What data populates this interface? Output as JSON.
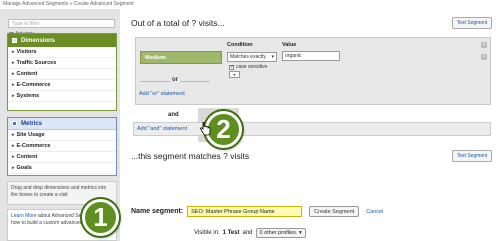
{
  "breadcrumb": "Manage Advanced Segments » Create Advanced Segment",
  "left_panel": {
    "filter_placeholder": "Type to filter",
    "list_view_label": "list view",
    "dimensions": {
      "title": "Dimensions",
      "items": [
        "Visitors",
        "Traffic Sources",
        "Content",
        "E-Commerce",
        "Systems"
      ]
    },
    "metrics": {
      "title": "Metrics",
      "items": [
        "Site Usage",
        "E-Commerce",
        "Content",
        "Goals"
      ]
    },
    "help_drag": "Drag and drop dimensions and metrics into the boxes to create a visit",
    "help_learn_link": "Learn More",
    "help_learn_text": "about Advanced Segments and how to build a custom advanced segment."
  },
  "main": {
    "total_title": "Out of a total of ? visits...",
    "test_segment_label": "Test Segment",
    "condition_header": "Condition",
    "value_header": "Value",
    "dimension_pill": "Medium",
    "condition_value": "Matches exactly",
    "value_text": "organic",
    "case_sensitive_label": "case sensitive",
    "or_label": "or",
    "add_or_label": "Add \"or\" statement",
    "and_label": "and",
    "add_and_label": "Add \"and\" statement",
    "matches_title": "...this segment matches ? visits",
    "name_label": "Name segment:",
    "name_value": "SEO: Master Phrase Group Name",
    "create_label": "Create Segment",
    "cancel_label": "Cancel",
    "visible_in_label": "Visible in:",
    "visible_in_value": "1 Test",
    "and_word": "and",
    "profiles_value": "0 other profiles."
  },
  "badges": {
    "one": "1",
    "two": "2"
  },
  "colors": {
    "dimensions_green": "#6b8e23",
    "metrics_blue": "#4c74b8",
    "badge_green": "#5e8f1f",
    "name_field": "#fffbb5",
    "link_blue": "#1a56b0"
  }
}
